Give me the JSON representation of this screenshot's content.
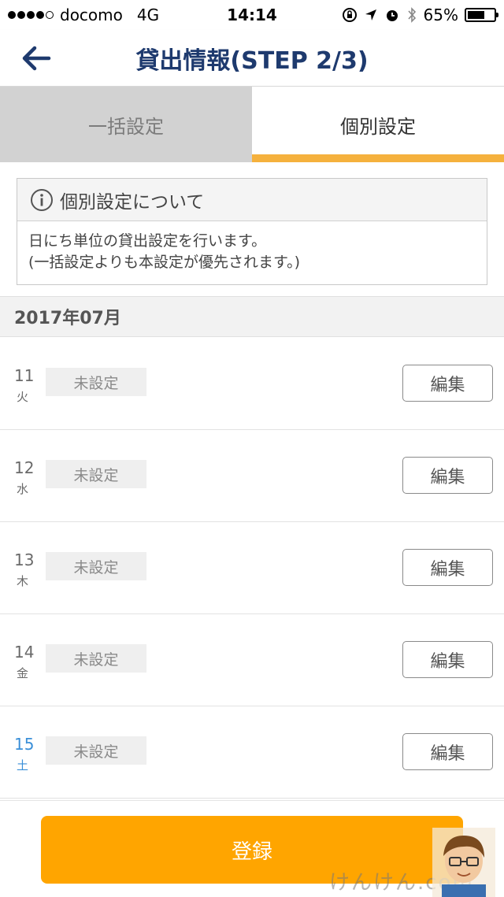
{
  "status_bar": {
    "carrier": "docomo",
    "network": "4G",
    "time": "14:14",
    "battery": "65%",
    "battery_level": 0.65,
    "signal_bars_filled": 4,
    "signal_bars_total": 5
  },
  "nav": {
    "title": "貸出情報(STEP 2/3)",
    "back_icon": "arrow-left-icon"
  },
  "tabs": [
    {
      "label": "一括設定",
      "active": false
    },
    {
      "label": "個別設定",
      "active": true
    }
  ],
  "info": {
    "icon": "info-icon",
    "title": "個別設定について",
    "line1": "日にち単位の貸出設定を行います。",
    "line2": "(一括設定よりも本設定が優先されます。)"
  },
  "month": "2017年07月",
  "days": [
    {
      "day": "11",
      "weekday": "火",
      "status": "未設定",
      "edit_label": "編集"
    },
    {
      "day": "12",
      "weekday": "水",
      "status": "未設定",
      "edit_label": "編集"
    },
    {
      "day": "13",
      "weekday": "木",
      "status": "未設定",
      "edit_label": "編集"
    },
    {
      "day": "14",
      "weekday": "金",
      "status": "未設定",
      "edit_label": "編集"
    },
    {
      "day": "15",
      "weekday": "土",
      "status": "未設定",
      "edit_label": "編集"
    }
  ],
  "footer": {
    "register_label": "登録",
    "watermark": "けんけん.com"
  },
  "colors": {
    "accent": "#ffa500",
    "tab_underline": "#f5b13d",
    "title": "#1e3a6e",
    "saturday": "#3a8fd8"
  }
}
